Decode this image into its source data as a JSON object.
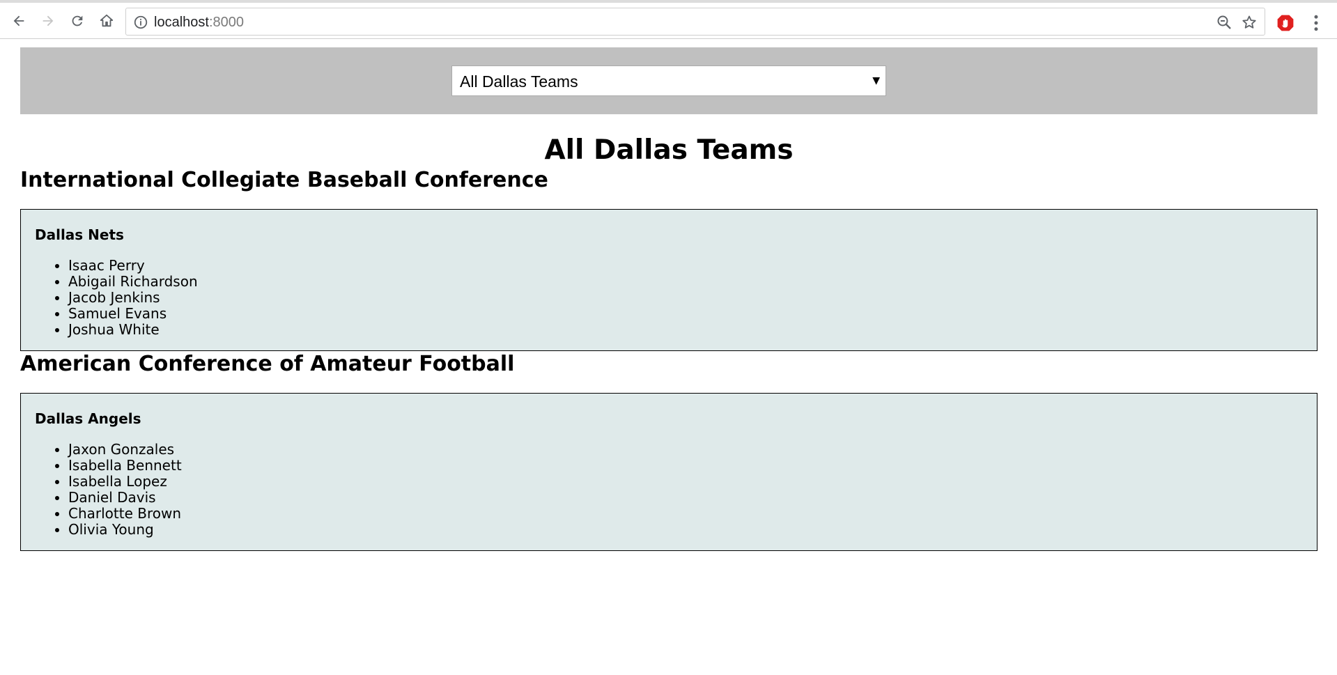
{
  "browser": {
    "url_host": "localhost",
    "url_port": ":8000",
    "icons": [
      "back-icon",
      "forward-icon",
      "reload-icon",
      "home-icon",
      "info-icon",
      "zoom-out-icon",
      "star-icon",
      "extension-icon",
      "more-vert-icon"
    ]
  },
  "header": {
    "selected_team": "All Dallas Teams"
  },
  "main": {
    "title": "All Dallas Teams",
    "conferences": [
      {
        "name": "International Collegiate Baseball Conference",
        "teams": [
          {
            "name": "Dallas Nets",
            "players": [
              "Isaac Perry",
              "Abigail Richardson",
              "Jacob Jenkins",
              "Samuel Evans",
              "Joshua White"
            ]
          }
        ]
      },
      {
        "name": "American Conference of Amateur Football",
        "teams": [
          {
            "name": "Dallas Angels",
            "players": [
              "Jaxon Gonzales",
              "Isabella Bennett",
              "Isabella Lopez",
              "Daniel Davis",
              "Charlotte Brown",
              "Olivia Young"
            ]
          }
        ]
      }
    ]
  },
  "colors": {
    "header_bar": "#c0c0c0",
    "team_box_bg": "#dfeaea",
    "extension_red": "#e0201f"
  }
}
